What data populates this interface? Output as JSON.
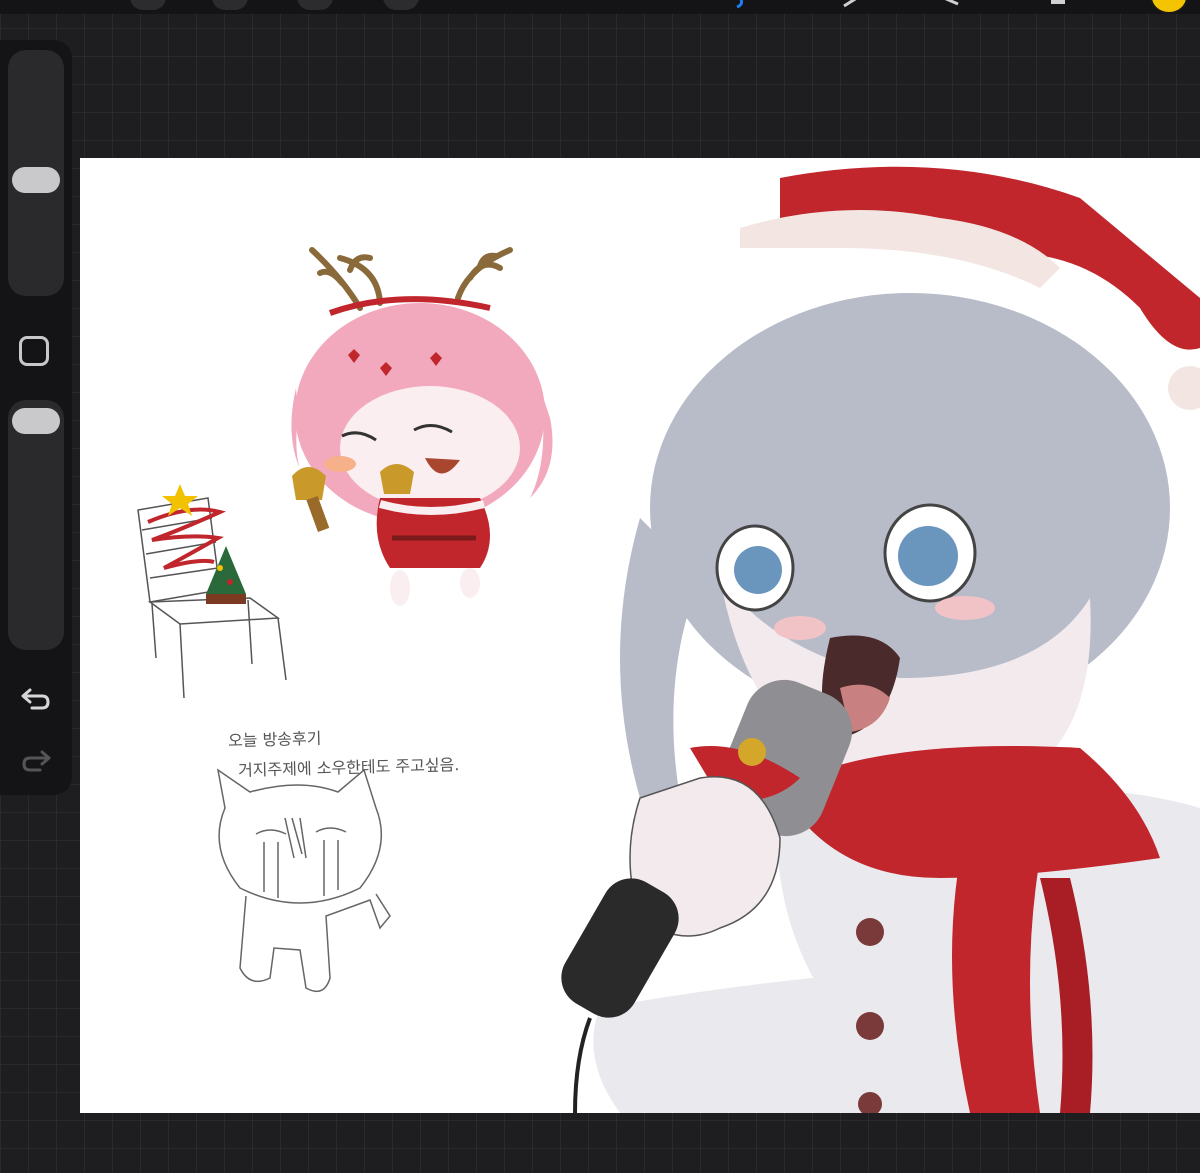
{
  "app": {
    "toolbar": {
      "buttons": [
        "gallery-button",
        "actions-button",
        "adjustments-button",
        "selection-button"
      ],
      "tools": [
        "brush-tool",
        "smudge-tool",
        "eraser-tool",
        "layers-button"
      ],
      "current_color": "#f5c400"
    },
    "sidebar": {
      "brush_size_icon": "slider",
      "modify_icon": "square-outline",
      "undo_icon": "undo-arrow",
      "redo_icon": "redo-arrow"
    }
  },
  "canvas": {
    "notes": {
      "line1": "오늘 방송후기",
      "line2": "거지주제에 소우한테도 주고싶음."
    },
    "accent_red": "#c0262c",
    "hair_grey": "#b7bcc8",
    "chibi_pink": "#f2a9bd"
  }
}
